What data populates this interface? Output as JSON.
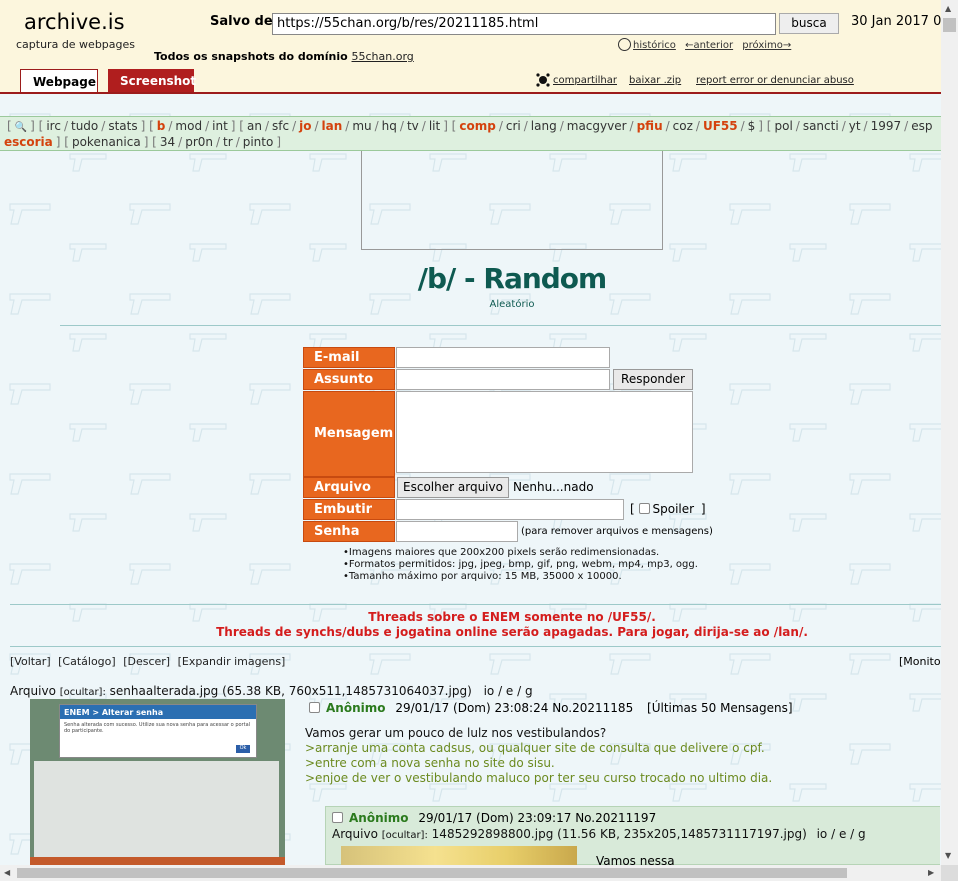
{
  "archive": {
    "logo": "archive.is",
    "tagline": "captura de webpages",
    "salvo_label": "Salvo de",
    "url": "https://55chan.org/b/res/20211185.html",
    "search_button": "busca",
    "date": "30 Jan 2017 0",
    "todos_label": "Todos os snapshots  do domínio",
    "todos_domain": "55chan.org",
    "history": "histórico",
    "previous": "←anterior",
    "next": "próximo→",
    "tab_webpage": "Webpage",
    "tab_screenshot": "Screenshot",
    "share": "compartilhar",
    "download": "baixar .zip",
    "report": "report error or denunciar abuso"
  },
  "nav": {
    "line1": [
      {
        "t": "[",
        "k": "sep"
      },
      {
        "t": "🔍",
        "k": "icon"
      },
      {
        "t": "] [",
        "k": "sep"
      },
      {
        "t": "irc",
        "k": "i"
      },
      {
        "t": "/",
        "k": "sep"
      },
      {
        "t": "tudo",
        "k": "i"
      },
      {
        "t": "/",
        "k": "sep"
      },
      {
        "t": "stats",
        "k": "i"
      },
      {
        "t": "] [",
        "k": "sep"
      },
      {
        "t": "b",
        "k": "hl"
      },
      {
        "t": "/",
        "k": "sep"
      },
      {
        "t": "mod",
        "k": "i"
      },
      {
        "t": "/",
        "k": "sep"
      },
      {
        "t": "int",
        "k": "i"
      },
      {
        "t": "] [",
        "k": "sep"
      },
      {
        "t": "an",
        "k": "i"
      },
      {
        "t": "/",
        "k": "sep"
      },
      {
        "t": "sfc",
        "k": "i"
      },
      {
        "t": "/",
        "k": "sep"
      },
      {
        "t": "jo",
        "k": "hl"
      },
      {
        "t": "/",
        "k": "sep"
      },
      {
        "t": "lan",
        "k": "hl"
      },
      {
        "t": "/",
        "k": "sep"
      },
      {
        "t": "mu",
        "k": "i"
      },
      {
        "t": "/",
        "k": "sep"
      },
      {
        "t": "hq",
        "k": "i"
      },
      {
        "t": "/",
        "k": "sep"
      },
      {
        "t": "tv",
        "k": "i"
      },
      {
        "t": "/",
        "k": "sep"
      },
      {
        "t": "lit",
        "k": "i"
      },
      {
        "t": "] [",
        "k": "sep"
      },
      {
        "t": "comp",
        "k": "hl"
      },
      {
        "t": "/",
        "k": "sep"
      },
      {
        "t": "cri",
        "k": "i"
      },
      {
        "t": "/",
        "k": "sep"
      },
      {
        "t": "lang",
        "k": "i"
      },
      {
        "t": "/",
        "k": "sep"
      },
      {
        "t": "macgyver",
        "k": "i"
      },
      {
        "t": "/",
        "k": "sep"
      },
      {
        "t": "pfiu",
        "k": "hl"
      },
      {
        "t": "/",
        "k": "sep"
      },
      {
        "t": "coz",
        "k": "i"
      },
      {
        "t": "/",
        "k": "sep"
      },
      {
        "t": "UF55",
        "k": "hl"
      },
      {
        "t": "/",
        "k": "sep"
      },
      {
        "t": "$",
        "k": "i"
      },
      {
        "t": "] [",
        "k": "sep"
      },
      {
        "t": "pol",
        "k": "i"
      },
      {
        "t": "/",
        "k": "sep"
      },
      {
        "t": "sancti",
        "k": "i"
      },
      {
        "t": "/",
        "k": "sep"
      },
      {
        "t": "yt",
        "k": "i"
      },
      {
        "t": "/",
        "k": "sep"
      },
      {
        "t": "1997",
        "k": "i"
      },
      {
        "t": "/",
        "k": "sep"
      },
      {
        "t": "esp",
        "k": "i"
      }
    ],
    "line2": [
      {
        "t": "escoria",
        "k": "hl"
      },
      {
        "t": "] [",
        "k": "sep"
      },
      {
        "t": "pokenanica",
        "k": "i"
      },
      {
        "t": "] [",
        "k": "sep"
      },
      {
        "t": "34",
        "k": "i"
      },
      {
        "t": "/",
        "k": "sep"
      },
      {
        "t": "pr0n",
        "k": "i"
      },
      {
        "t": "/",
        "k": "sep"
      },
      {
        "t": "tr",
        "k": "i"
      },
      {
        "t": "/",
        "k": "sep"
      },
      {
        "t": "pinto",
        "k": "i"
      },
      {
        "t": "]",
        "k": "sep"
      }
    ]
  },
  "board": {
    "title": "/b/ - Random",
    "subtitle": "Aleatório"
  },
  "form": {
    "email_label": "E-mail",
    "subject_label": "Assunto",
    "submit": "Responder",
    "message_label": "Mensagem",
    "file_label": "Arquivo",
    "choose_file": "Escolher arquivo",
    "no_file": "Nenhu...nado",
    "embed_label": "Embutir",
    "spoiler_open": "[",
    "spoiler": "Spoiler",
    "spoiler_close": "]",
    "password_label": "Senha",
    "password_hint": "(para remover arquivos e mensagens)",
    "rules": [
      "Imagens maiores que 200x200 pixels serão redimensionadas.",
      "Formatos permitidos: jpg, jpeg, bmp, gif, png, webm, mp4, mp3, ogg.",
      "Tamanho máximo por arquivo: 15 MB, 35000 x 10000."
    ]
  },
  "announcements": [
    "Threads sobre o ENEM somente no /UF55/.",
    "Threads de synchs/dubs e jogatina online serão apagadas. Para jogar, dirija-se ao /lan/."
  ],
  "actions": [
    "[Voltar]",
    "[Catálogo]",
    "[Descer]",
    "[Expandir imagens]"
  ],
  "monitor": "[Monitora",
  "op": {
    "file_prefix": "Arquivo",
    "hide": "[ocultar]:",
    "filename": "senhaalterada.jpg",
    "fileinfo": "(65.38 KB, 760x511,1485731064037.jpg)",
    "search_links": "io / e / g",
    "name": "Anônimo",
    "date": "29/01/17 (Dom) 23:08:24",
    "number": "No.20211185",
    "last50": "[Últimas 50 Mensagens]",
    "lines": [
      {
        "t": "Vamos gerar um pouco de lulz nos vestibulandos?",
        "gt": false
      },
      {
        "t": ">arranje uma conta cadsus, ou qualquer site de consulta que delivere o cpf.",
        "gt": true
      },
      {
        "t": ">entre com a nova senha no site do sisu.",
        "gt": true
      },
      {
        "t": ">enjoe de ver o vestibulando maluco por ter seu curso trocado no ultimo dia.",
        "gt": true
      }
    ],
    "thumb": {
      "dialog_title": "ENEM > Alterar senha",
      "dialog_text": "Senha alterada com sucesso. Utilize sua nova senha para acessar o portal do participante.",
      "ok": "Ok"
    }
  },
  "reply": {
    "name": "Anônimo",
    "date": "29/01/17 (Dom) 23:09:17",
    "number": "No.20211197",
    "file_prefix": "Arquivo",
    "hide": "[ocultar]:",
    "filename": "1485292898800.jpg",
    "fileinfo": "(11.56 KB, 235x205,1485731117197.jpg)",
    "search_links": "io / e / g",
    "body_start": "Vamos nessa"
  }
}
